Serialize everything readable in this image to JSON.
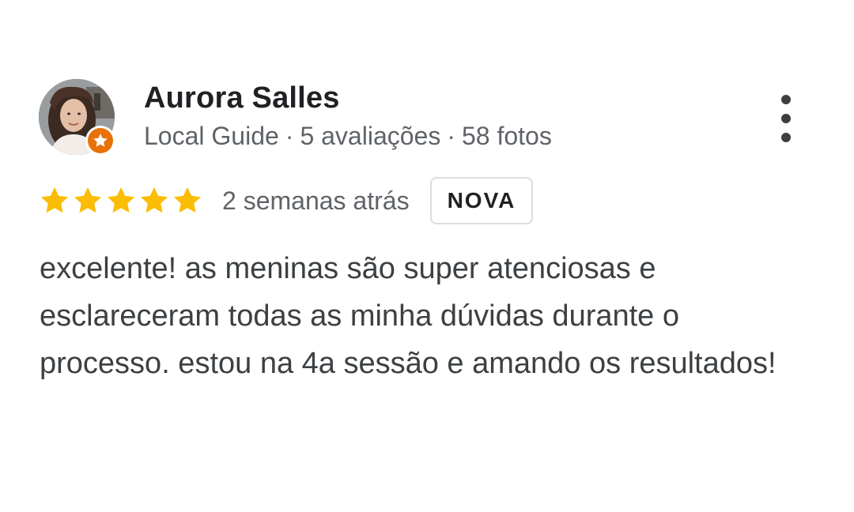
{
  "reviewer": {
    "name": "Aurora Salles",
    "level": "Local Guide",
    "separator": "·",
    "reviews_count": "5 avaliações",
    "photos_count": "58 fotos"
  },
  "rating": {
    "stars": 5,
    "max_stars": 5,
    "star_color": "#fbbc04",
    "date": "2 semanas atrás",
    "badge": "NOVA"
  },
  "review": {
    "text": "excelente! as meninas são super atenciosas e esclareceram todas as minha dúvidas durante o processo. estou na 4a sessão e amando os resultados!"
  },
  "icons": {
    "guide_badge": "star-icon",
    "guide_badge_color": "#e8710a",
    "menu": "more-vert-icon"
  }
}
